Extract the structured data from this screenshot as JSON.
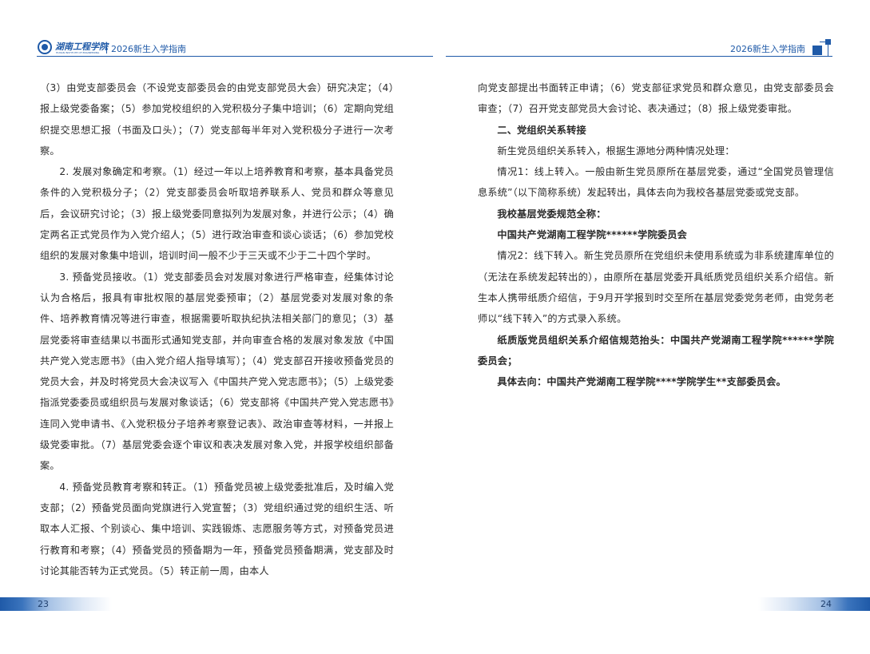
{
  "header": {
    "logo_text": "湖南工程学院",
    "logo_sub": "HUNAN INSTITUTE OF ENGINEERING",
    "title_left": "2026新生入学指南",
    "title_right": "2026新生入学指南"
  },
  "left_column": [
    {
      "text": "（3）由党支部委员会（不设党支部委员会的由党支部党员大会）研究决定；（4）报上级党委备案；（5）参加党校组织的入党积极分子集中培训；（6）定期向党组织提交思想汇报（书面及口头）；（7）党支部每半年对入党积极分子进行一次考察。",
      "indent": false,
      "bold": false
    },
    {
      "text": "2. 发展对象确定和考察。（1）经过一年以上培养教育和考察，基本具备党员条件的入党积极分子；（2）党支部委员会听取培养联系人、党员和群众等意见后，会议研究讨论；（3）报上级党委同意拟列为发展对象，并进行公示；（4）确定两名正式党员作为入党介绍人；（5）进行政治审查和谈心谈话；（6）参加党校组织的发展对象集中培训，培训时间一般不少于三天或不少于二十四个学时。",
      "indent": true,
      "bold": false
    },
    {
      "text": "3. 预备党员接收。（1）党支部委员会对发展对象进行严格审查，经集体讨论认为合格后，报具有审批权限的基层党委预审；（2）基层党委对发展对象的条件、培养教育情况等进行审查，根据需要听取执纪执法相关部门的意见；（3）基层党委将审查结果以书面形式通知党支部，并向审查合格的发展对象发放《中国共产党入党志愿书》（由入党介绍人指导填写）；（4）党支部召开接收预备党员的党员大会，并及时将党员大会决议写入《中国共产党入党志愿书》；（5）上级党委指派党委委员或组织员与发展对象谈话；（6）党支部将《中国共产党入党志愿书》连同入党申请书、《入党积极分子培养考察登记表》、政治审查等材料，一并报上级党委审批。（7）基层党委会逐个审议和表决发展对象入党，并报学校组织部备案。",
      "indent": true,
      "bold": false
    },
    {
      "text": "4. 预备党员教育考察和转正。（1）预备党员被上级党委批准后，及时编入党支部；（2）预备党员面向党旗进行入党宣誓；（3）党组织通过党的组织生活、听取本人汇报、个别谈心、集中培训、实践锻炼、志愿服务等方式，对预备党员进行教育和考察；（4）预备党员的预备期为一年，预备党员预备期满，党支部及时讨论其能否转为正式党员。（5）转正前一周，由本人",
      "indent": true,
      "bold": false
    }
  ],
  "right_column": [
    {
      "text": "向党支部提出书面转正申请；（6）党支部征求党员和群众意见，由党支部委员会审查；（7）召开党支部党员大会讨论、表决通过；（8）报上级党委审批。",
      "indent": false,
      "bold": false
    },
    {
      "text": "二、党组织关系转接",
      "indent": true,
      "bold": true
    },
    {
      "text": "新生党员组织关系转入，根据生源地分两种情况处理：",
      "indent": true,
      "bold": false
    },
    {
      "text": "情况1：线上转入。一般由新生党员原所在基层党委，通过“全国党员管理信息系统”（以下简称系统）发起转出，具体去向为我校各基层党委或党支部。",
      "indent": true,
      "bold": false
    },
    {
      "text": "我校基层党委规范全称：",
      "indent": true,
      "bold": true
    },
    {
      "text": "中国共产党湖南工程学院******学院委员会",
      "indent": true,
      "bold": true
    },
    {
      "text": "情况2：线下转入。新生党员原所在党组织未使用系统或为非系统建库单位的（无法在系统发起转出的），由原所在基层党委开具纸质党员组织关系介绍信。新生本人携带纸质介绍信，于9月开学报到时交至所在基层党委党务老师，由党务老师以“线下转入”的方式录入系统。",
      "indent": true,
      "bold": false
    },
    {
      "text": "纸质版党员组织关系介绍信规范抬头：中国共产党湖南工程学院******学院委员会；",
      "indent": true,
      "bold": true
    },
    {
      "text": "具体去向：中国共产党湖南工程学院****学院学生**支部委员会。",
      "indent": true,
      "bold": true
    }
  ],
  "footer": {
    "page_left": "23",
    "page_right": "24"
  },
  "colors": {
    "brand_blue": "#1f5aa8"
  }
}
